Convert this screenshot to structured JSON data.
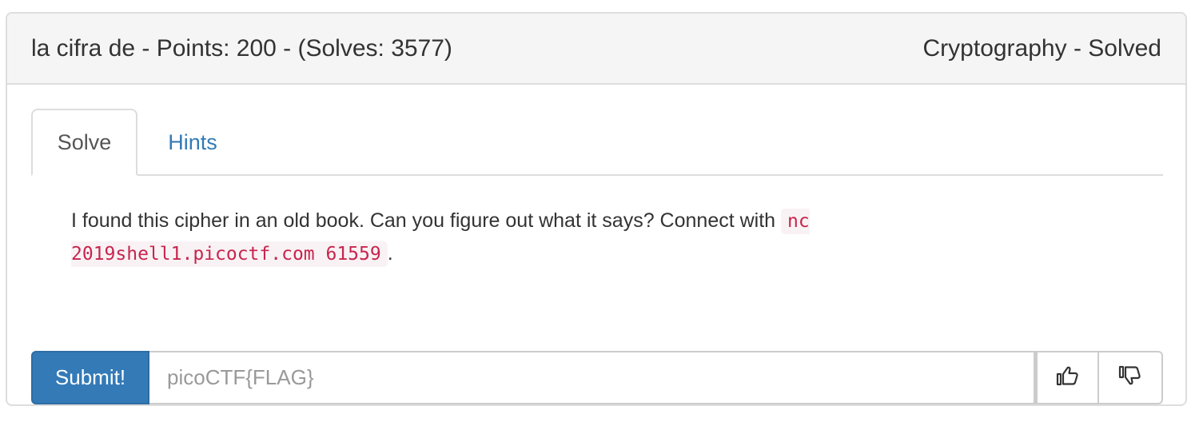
{
  "challenge": {
    "heading_left": "la cifra de - Points: 200 - (Solves: 3577)",
    "heading_right": "Cryptography - Solved"
  },
  "tabs": [
    {
      "label": "Solve",
      "active": true
    },
    {
      "label": "Hints",
      "active": false
    }
  ],
  "description": {
    "text_before": "I found this cipher in an old book. Can you figure out what it says? Connect with ",
    "code": "nc 2019shell1.picoctf.com 61559",
    "text_after": "."
  },
  "form": {
    "submit_label": "Submit!",
    "flag_placeholder": "picoCTF{FLAG}",
    "flag_value": ""
  },
  "icons": {
    "upvote": "thumbs-up-icon",
    "downvote": "thumbs-down-icon"
  },
  "colors": {
    "primary": "#337ab7",
    "code_text": "#c7254e",
    "code_bg": "#f9f2f4",
    "heading_bg": "#f5f5f5"
  }
}
